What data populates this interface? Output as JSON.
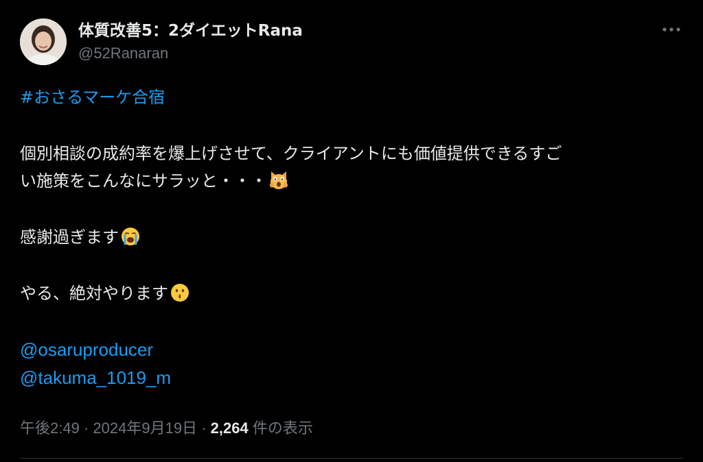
{
  "author": {
    "display_name": "体質改善5：2ダイエットRana",
    "handle": "@52Ranaran"
  },
  "tweet": {
    "hashtag": "#おさるマーケ合宿",
    "line1": "個別相談の成約率を爆上げさせて、クライアントにも価値提供できるすご",
    "line2": "い施策をこんなにサラッと・・・",
    "line3": "感謝過ぎます",
    "line4": "やる、絶対やります",
    "mention1": "@osaruproducer",
    "mention2": "@takuma_1019_m"
  },
  "emojis": {
    "line2": "scream-cat-emoji",
    "line3": "loudly-crying-face-emoji",
    "line4": "kissing-face-emoji"
  },
  "meta": {
    "time": "午後2:49",
    "separator": "·",
    "date": "2024年9月19日",
    "views_count": "2,264",
    "views_label": "件の表示"
  },
  "colors": {
    "background": "#000000",
    "text": "#e7e9ea",
    "secondary": "#71767b",
    "link": "#1d9bf0",
    "divider": "#2f3336"
  }
}
